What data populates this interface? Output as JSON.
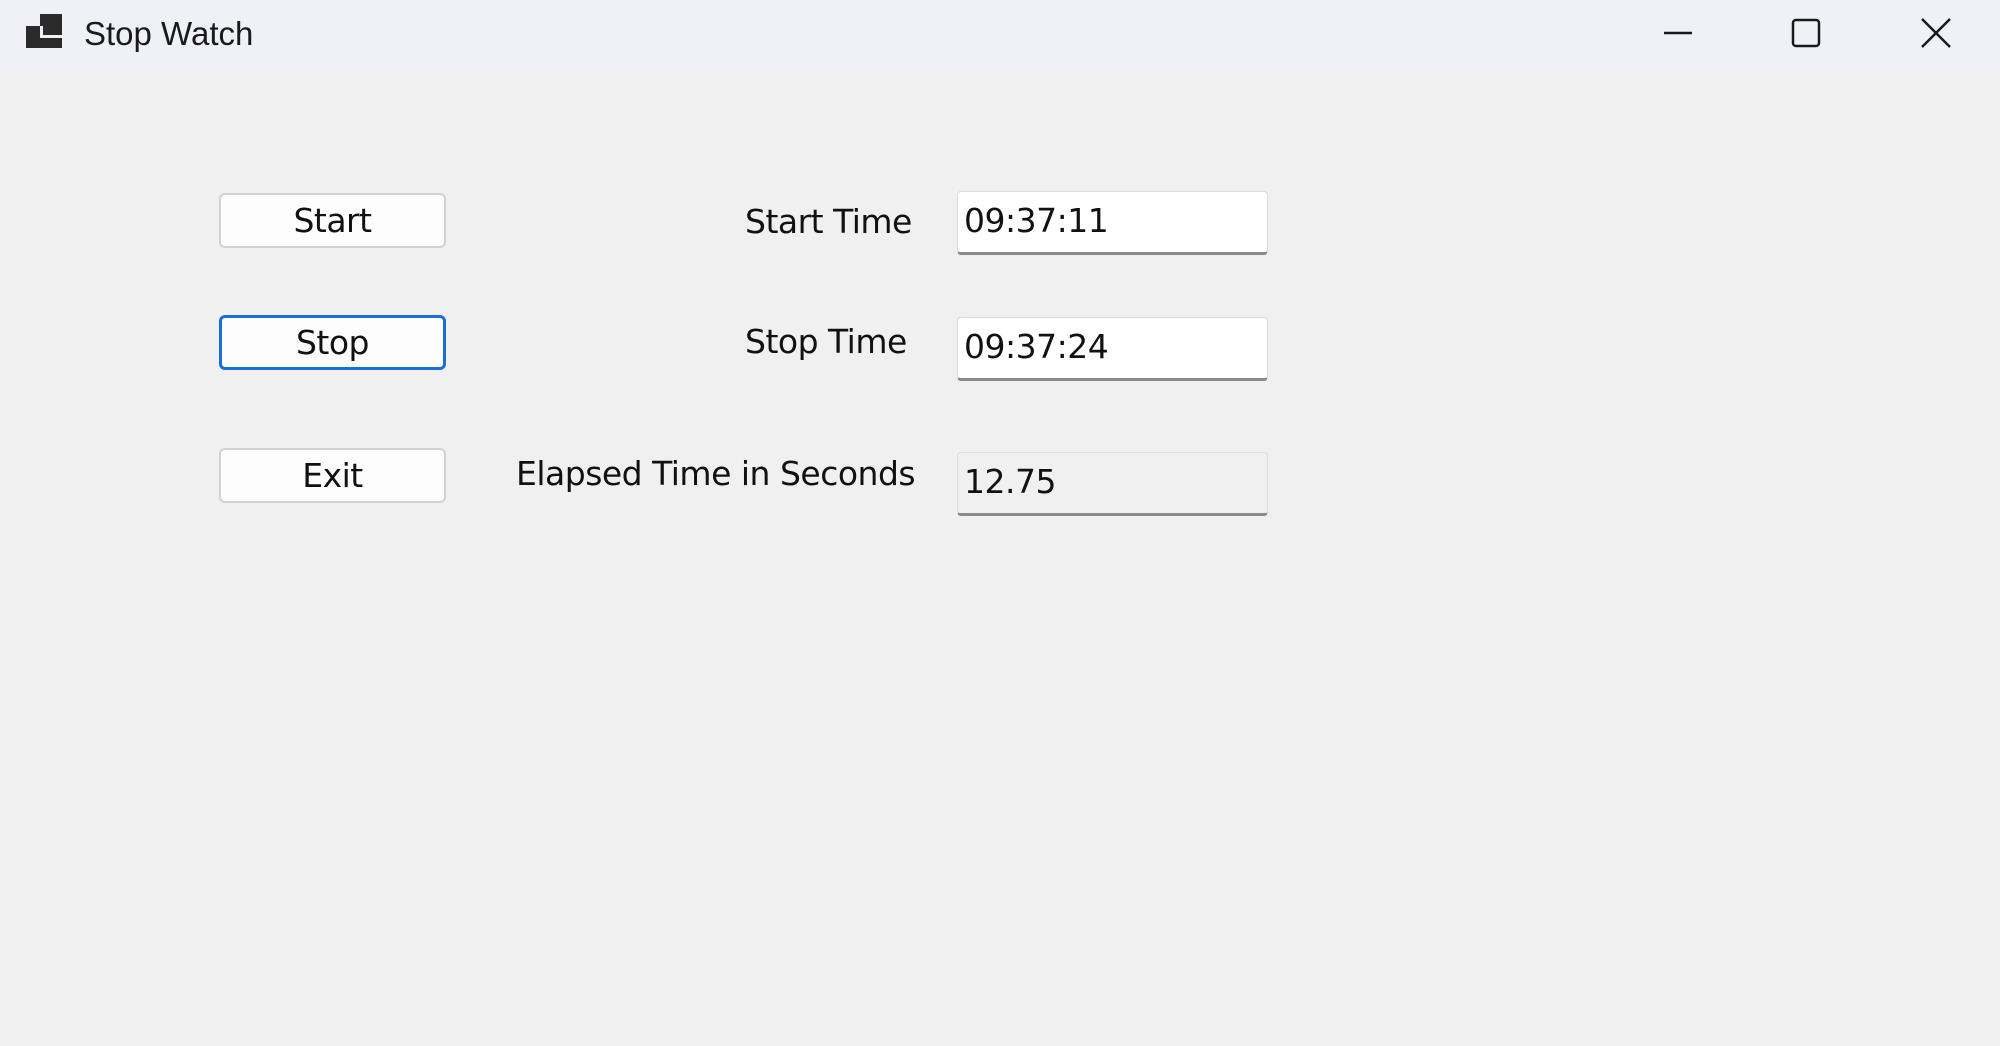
{
  "window": {
    "title": "Stop Watch",
    "icon": "app-window-icon"
  },
  "controls": {
    "minimize_icon": "minimize-icon",
    "maximize_icon": "maximize-icon",
    "close_icon": "close-icon"
  },
  "buttons": {
    "start": "Start",
    "stop": "Stop",
    "exit": "Exit"
  },
  "labels": {
    "start_time": "Start Time",
    "stop_time": "Stop Time",
    "elapsed": "Elapsed Time in Seconds"
  },
  "fields": {
    "start_time": "09:37:11",
    "stop_time": "09:37:24",
    "elapsed": "12.75"
  },
  "colors": {
    "accent": "#1a6fd6",
    "titlebar": "#eff1f7",
    "background": "#f0f0f0"
  }
}
